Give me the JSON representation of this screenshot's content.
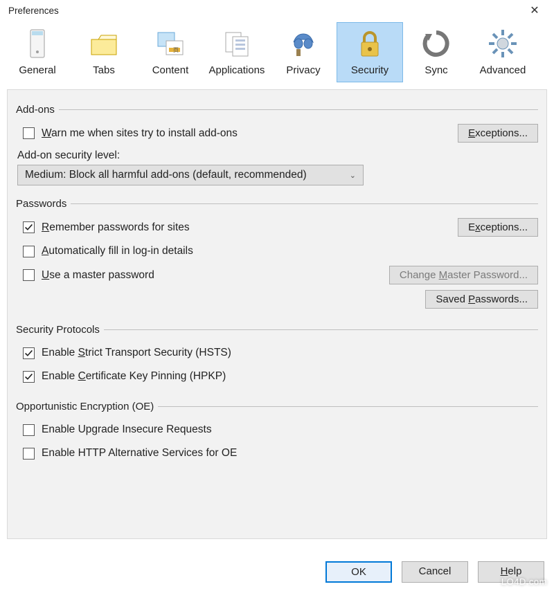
{
  "window": {
    "title": "Preferences"
  },
  "tabs": [
    {
      "id": "general",
      "label": "General",
      "selected": false
    },
    {
      "id": "tabs",
      "label": "Tabs",
      "selected": false
    },
    {
      "id": "content",
      "label": "Content",
      "selected": false
    },
    {
      "id": "applications",
      "label": "Applications",
      "selected": false
    },
    {
      "id": "privacy",
      "label": "Privacy",
      "selected": false
    },
    {
      "id": "security",
      "label": "Security",
      "selected": true
    },
    {
      "id": "sync",
      "label": "Sync",
      "selected": false
    },
    {
      "id": "advanced",
      "label": "Advanced",
      "selected": false
    }
  ],
  "groups": {
    "addons": {
      "legend": "Add-ons",
      "warn_label": "Warn me when sites try to install add-ons",
      "warn_checked": false,
      "exceptions_btn": "Exceptions...",
      "level_label": "Add-on security level:",
      "level_value": "Medium: Block all harmful add-ons (default, recommended)"
    },
    "passwords": {
      "legend": "Passwords",
      "remember_label": "Remember passwords for sites",
      "remember_checked": true,
      "autofill_label": "Automatically fill in log-in details",
      "autofill_checked": false,
      "master_label": "Use a master password",
      "master_checked": false,
      "exceptions_btn": "Exceptions...",
      "change_master_btn": "Change Master Password...",
      "saved_btn": "Saved Passwords..."
    },
    "protocols": {
      "legend": "Security Protocols",
      "hsts_label": "Enable Strict Transport Security (HSTS)",
      "hsts_checked": true,
      "hpkp_label": "Enable Certificate Key Pinning (HPKP)",
      "hpkp_checked": true
    },
    "oe": {
      "legend": "Opportunistic Encryption (OE)",
      "upgrade_label": "Enable Upgrade Insecure Requests",
      "upgrade_checked": false,
      "altsvc_label": "Enable HTTP Alternative Services for OE",
      "altsvc_checked": false
    }
  },
  "buttons": {
    "ok": "OK",
    "cancel": "Cancel",
    "help": "Help"
  },
  "watermark": "LO4D.com"
}
